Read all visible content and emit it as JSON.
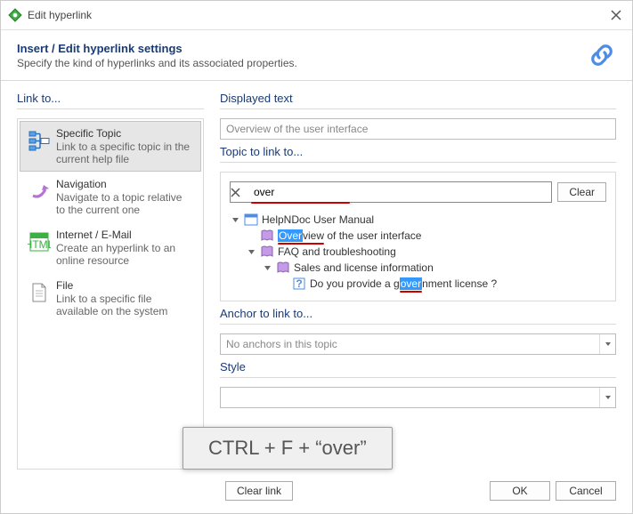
{
  "window": {
    "title": "Edit hyperlink"
  },
  "header": {
    "title": "Insert / Edit hyperlink settings",
    "desc": "Specify the kind of hyperlinks and its associated properties."
  },
  "left": {
    "section_title": "Link to...",
    "types": [
      {
        "title": "Specific Topic",
        "desc": "Link to a specific topic in the current help file"
      },
      {
        "title": "Navigation",
        "desc": "Navigate to a topic relative to the current one"
      },
      {
        "title": "Internet / E-Mail",
        "desc": "Create an hyperlink to an online resource"
      },
      {
        "title": "File",
        "desc": "Link to a specific file available on the system"
      }
    ]
  },
  "right": {
    "displayed_text": {
      "label": "Displayed text",
      "value": "Overview of the user interface"
    },
    "topic": {
      "label": "Topic to link to...",
      "search_value": "over",
      "clear_button": "Clear",
      "tree": {
        "root": "HelpNDoc User Manual",
        "item1_pre": "Over",
        "item1_mid": "view",
        "item1_post": " of the user interface",
        "item2": "FAQ and troubleshooting",
        "item3": "Sales and license information",
        "item4_pre": "Do you provide a g",
        "item4_mid": "over",
        "item4_post": "nment license ?"
      }
    },
    "anchor": {
      "label": "Anchor to link to...",
      "value": "No anchors in this topic"
    },
    "style": {
      "label": "Style"
    }
  },
  "footer": {
    "clear_link": "Clear link",
    "ok": "OK",
    "cancel": "Cancel"
  },
  "overlay": {
    "text": "CTRL + F + “over”"
  }
}
